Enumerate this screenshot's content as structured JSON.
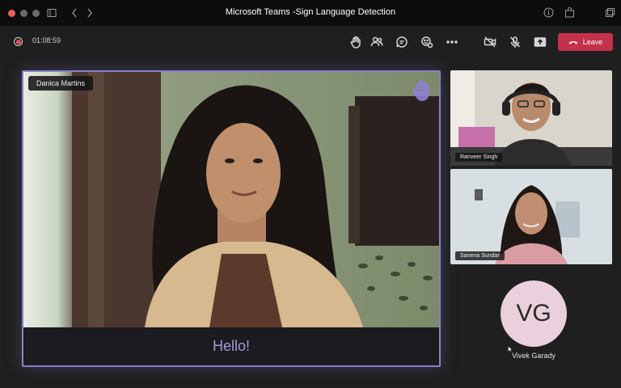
{
  "window": {
    "title": "Microsoft Teams -Sign Language Detection"
  },
  "toolbar": {
    "timer": "01:08:59",
    "leave_label": "Leave",
    "buttons": [
      {
        "name": "raise-hand-icon"
      },
      {
        "name": "people-icon"
      },
      {
        "name": "chat-icon"
      },
      {
        "name": "reactions-icon"
      },
      {
        "name": "more-options-icon"
      },
      {
        "name": "camera-off-icon"
      },
      {
        "name": "mic-off-icon"
      },
      {
        "name": "share-screen-icon"
      }
    ]
  },
  "main_participant": {
    "name": "Danica Martins",
    "caption": "Hello!"
  },
  "participants": [
    {
      "name": "Ranveer Singh"
    },
    {
      "name": "Sanena Sundar"
    }
  ],
  "avatar_participant": {
    "initials": "VG",
    "name": "Vivek Garady"
  },
  "colors": {
    "accent": "#8a80c8",
    "caption": "#a49ad8",
    "leave": "#c4314b",
    "avatar_bg": "#ead0dc"
  }
}
